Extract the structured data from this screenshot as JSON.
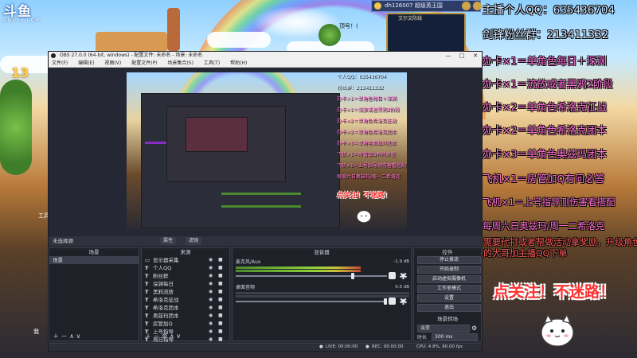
{
  "logo": {
    "main": "斗鱼",
    "sub": "DOUYU.COM"
  },
  "game": {
    "topbar_text": "dh126007 超级英王国",
    "minimap_label": "艾尔文防线",
    "hint": "顶号！(",
    "level_badge": "13",
    "side_label_1": "工具",
    "side_label_2": "我"
  },
  "overlay": {
    "qq": "主播个人QQ：635436704",
    "fan_group": "剑锋粉丝群：213411332",
    "items": [
      "办卡×1＝单角色每日＋深渊",
      "办卡×1＝流放或者黑鸦2阶段",
      "办卡×2＝单角色希洛克征战",
      "办卡×2＝单角色希洛克团本",
      "办卡×3＝单角色奥兹玛团本",
      "飞机×1＝房管加Q有问必答",
      "飞机×1＝上号指导测伤害看搭配",
      "每周六日奥兹玛/周一二希洛克"
    ],
    "notice": "需要代打或者帮做活动拿奖励，升级角色的大哥加主播QQ下单",
    "follow": "点关注！不迷路！"
  },
  "obs": {
    "title": "OBS 27.0.0 (64-bit, windows) - 配置文件: 未命名 - 场景: 未命名",
    "menu": [
      "文件(F)",
      "编辑(E)",
      "视图(V)",
      "配置文件(P)",
      "场景集合(S)",
      "工具(T)",
      "帮助(H)"
    ],
    "window_controls": {
      "minimize": "—",
      "maximize": "□",
      "close": "✕"
    },
    "source_bar": {
      "label": "未选择源",
      "properties": "属性",
      "filters": "滤镜"
    },
    "panels": {
      "scenes_title": "场景",
      "sources_title": "来源",
      "mixer_title": "混音器",
      "controls_title": "控件"
    },
    "scenes": [
      "场景"
    ],
    "sources": [
      {
        "icon": "monitor",
        "name": "显示器采集"
      },
      {
        "icon": "text",
        "name": "个人QQ"
      },
      {
        "icon": "text",
        "name": "粉丝群"
      },
      {
        "icon": "text",
        "name": "深渊每日"
      },
      {
        "icon": "text",
        "name": "黑鸦流放"
      },
      {
        "icon": "text",
        "name": "希洛克征战"
      },
      {
        "icon": "text",
        "name": "希洛克团本"
      },
      {
        "icon": "text",
        "name": "奥兹玛团本"
      },
      {
        "icon": "text",
        "name": "房管加Q"
      },
      {
        "icon": "text",
        "name": "上号指导"
      },
      {
        "icon": "text",
        "name": "周日指导"
      }
    ],
    "mixer": [
      {
        "name": "麦克风/Aux",
        "db": "-1.9 dB",
        "level": 0.72,
        "volume": 0.78
      },
      {
        "name": "桌面音频",
        "db": "0.0 dB",
        "level": 0.0,
        "volume": 1.0
      }
    ],
    "controls": [
      "停止推流",
      "开始录制",
      "启动虚拟摄像机",
      "工作室模式",
      "设置",
      "退出"
    ],
    "transition": {
      "title": "场景转场",
      "type": "淡变",
      "duration_label": "时长",
      "duration": "300 ms"
    },
    "status": {
      "live": "LIVE: 00:00:00",
      "rec": "REC: 00:00:00",
      "cpu": "CPU: 4.8%, 60.00 fps"
    },
    "preview_overlay": {
      "qq": "个人QQ：635436704",
      "fan": "粉丝群：213411332",
      "items": [
        "办卡×1＝单角色每日＋深渊",
        "办卡×1＝流放或者黑鸦2阶段",
        "办卡×2＝单角色希洛克征战",
        "办卡×2＝单角色希洛克团本",
        "办卡×3＝单角色奥兹玛团本",
        "飞机×1＝房管加Q有问必答",
        "飞机×1＝上号指导测伤害看搭配",
        "每周六日奥兹玛/周一二希洛克"
      ],
      "follow": "点关注！不迷路！"
    }
  },
  "colors": {
    "overlay_item": "#ff6fd8",
    "overlay_info": "#d6e8ff",
    "follow_red": "#ff3030",
    "obs_dark": "#2b2e38"
  }
}
